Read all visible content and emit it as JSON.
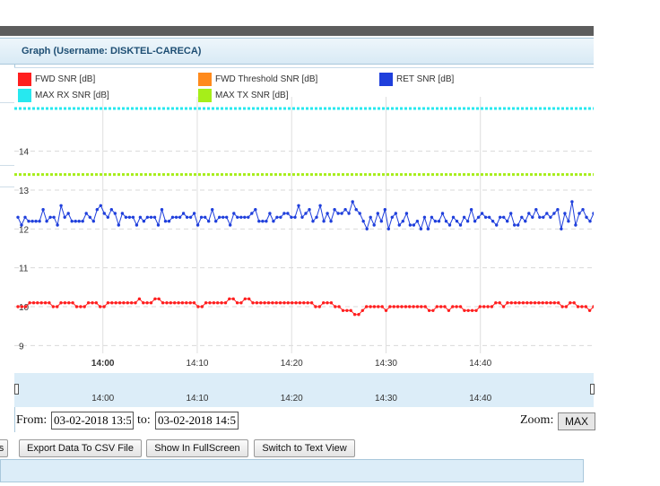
{
  "panel": {
    "title": "Graph (Username: DISKTEL-CARECA)"
  },
  "colors": {
    "fwd_snr": "#ff1f1f",
    "fwd_threshold": "#ff8a1c",
    "ret_snr": "#1f3fdc",
    "max_rx": "#27e8ef",
    "max_tx": "#a6ee19"
  },
  "chart_data": {
    "type": "line",
    "title": "",
    "xlabel": "",
    "ylabel": "",
    "ylim": [
      8.8,
      15.4
    ],
    "yticks": [
      9,
      10,
      11,
      12,
      13,
      14
    ],
    "xticks": [
      "14:00",
      "14:10",
      "14:20",
      "14:30",
      "14:40"
    ],
    "xtick_bold": [
      "14:00"
    ],
    "grid": true,
    "legend_position": "top",
    "x_range": [
      "13:51",
      "14:52"
    ],
    "series": [
      {
        "name": "FWD SNR [dB]",
        "color_key": "fwd_snr",
        "shape": "line",
        "values": [
          10.0,
          10.0,
          10.0,
          10.1,
          10.1,
          10.1,
          10.1,
          10.1,
          10.1,
          10.0,
          10.0,
          10.1,
          10.1,
          10.1,
          10.1,
          10.0,
          10.0,
          10.0,
          10.1,
          10.1,
          10.1,
          10.0,
          10.0,
          10.1,
          10.1,
          10.1,
          10.1,
          10.1,
          10.1,
          10.1,
          10.1,
          10.2,
          10.1,
          10.1,
          10.1,
          10.2,
          10.2,
          10.1,
          10.1,
          10.1,
          10.1,
          10.1,
          10.1,
          10.1,
          10.1,
          10.1,
          10.0,
          10.0,
          10.1,
          10.1,
          10.1,
          10.1,
          10.1,
          10.1,
          10.2,
          10.2,
          10.1,
          10.1,
          10.2,
          10.2,
          10.1,
          10.1,
          10.1,
          10.1,
          10.1,
          10.1,
          10.1,
          10.1,
          10.1,
          10.1,
          10.1,
          10.1,
          10.1,
          10.1,
          10.1,
          10.1,
          10.0,
          10.0,
          10.1,
          10.1,
          10.1,
          10.0,
          10.0,
          9.9,
          9.9,
          9.9,
          9.8,
          9.8,
          9.9,
          10.0,
          10.0,
          10.0,
          10.0,
          10.0,
          9.9,
          10.0,
          10.0,
          10.0,
          10.0,
          10.0,
          10.0,
          10.0,
          10.0,
          10.0,
          10.0,
          9.9,
          9.9,
          10.0,
          10.0,
          10.0,
          9.9,
          10.0,
          10.0,
          10.0,
          9.9,
          9.9,
          9.9,
          9.9,
          10.0,
          10.0,
          10.0,
          10.0,
          10.1,
          10.1,
          10.0,
          10.1,
          10.1,
          10.1,
          10.1,
          10.1,
          10.1,
          10.1,
          10.1,
          10.1,
          10.1,
          10.1,
          10.1,
          10.1,
          10.1,
          10.0,
          10.0,
          10.1,
          10.1,
          10.0,
          10.0,
          10.0,
          9.9,
          10.0
        ]
      },
      {
        "name": "FWD Threshold SNR [dB]",
        "color_key": "fwd_threshold",
        "shape": "none",
        "values": []
      },
      {
        "name": "RET SNR [dB]",
        "color_key": "ret_snr",
        "shape": "line",
        "values": [
          12.3,
          12.1,
          12.3,
          12.2,
          12.2,
          12.2,
          12.2,
          12.5,
          12.2,
          12.3,
          12.3,
          12.1,
          12.6,
          12.3,
          12.4,
          12.2,
          12.2,
          12.2,
          12.2,
          12.4,
          12.3,
          12.2,
          12.5,
          12.6,
          12.4,
          12.3,
          12.5,
          12.4,
          12.1,
          12.4,
          12.3,
          12.3,
          12.3,
          12.1,
          12.3,
          12.2,
          12.3,
          12.3,
          12.3,
          12.1,
          12.5,
          12.2,
          12.2,
          12.3,
          12.3,
          12.3,
          12.4,
          12.3,
          12.3,
          12.4,
          12.1,
          12.3,
          12.3,
          12.2,
          12.5,
          12.2,
          12.3,
          12.3,
          12.3,
          12.1,
          12.4,
          12.3,
          12.3,
          12.3,
          12.3,
          12.4,
          12.5,
          12.2,
          12.2,
          12.2,
          12.4,
          12.2,
          12.3,
          12.3,
          12.4,
          12.4,
          12.3,
          12.3,
          12.6,
          12.3,
          12.4,
          12.5,
          12.2,
          12.3,
          12.6,
          12.2,
          12.4,
          12.2,
          12.5,
          12.4,
          12.4,
          12.5,
          12.4,
          12.7,
          12.5,
          12.4,
          12.2,
          12.0,
          12.3,
          12.1,
          12.4,
          12.2,
          12.5,
          12.0,
          12.3,
          12.4,
          12.1,
          12.2,
          12.4,
          12.1,
          12.1,
          12.2,
          12.0,
          12.3,
          12.0,
          12.3,
          12.2,
          12.2,
          12.4,
          12.2,
          12.1,
          12.3,
          12.2,
          12.1,
          12.3,
          12.2,
          12.5,
          12.2,
          12.3,
          12.4,
          12.3,
          12.3,
          12.2,
          12.1,
          12.3,
          12.3,
          12.2,
          12.4,
          12.1,
          12.1,
          12.3,
          12.2,
          12.4,
          12.3,
          12.5,
          12.3,
          12.3,
          12.4,
          12.3,
          12.4,
          12.5,
          12.0,
          12.4,
          12.2,
          12.7,
          12.1,
          12.4,
          12.5,
          12.3,
          12.2,
          12.4
        ]
      },
      {
        "name": "MAX RX SNR [dB]",
        "color_key": "max_rx",
        "shape": "dots",
        "values": [
          15.1
        ]
      },
      {
        "name": "MAX TX SNR [dB]",
        "color_key": "max_tx",
        "shape": "dots",
        "values": [
          13.4
        ]
      }
    ]
  },
  "navigator": {
    "labels": [
      "14:00",
      "14:10",
      "14:20",
      "14:30",
      "14:40"
    ]
  },
  "range": {
    "from_label": "From:",
    "from_value": "03-02-2018 13:5",
    "to_label": "to:",
    "to_value": "03-02-2018 14:5",
    "zoom_label": "Zoom:",
    "zoom_value": "MAX"
  },
  "buttons": {
    "prev_partial": "s",
    "export_csv": "Export Data To CSV File",
    "fullscreen": "Show In FullScreen",
    "text_view": "Switch to Text View"
  }
}
